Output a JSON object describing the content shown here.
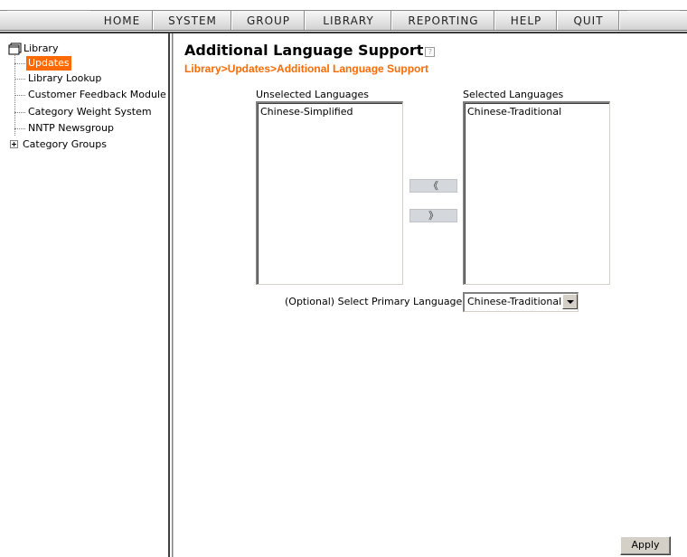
{
  "menu": {
    "items": [
      "HOME",
      "SYSTEM",
      "GROUP",
      "LIBRARY",
      "REPORTING",
      "HELP",
      "QUIT"
    ]
  },
  "sidebar": {
    "root": {
      "label": "Library",
      "icon": "folder-icon"
    },
    "items": [
      {
        "label": "Updates",
        "selected": true
      },
      {
        "label": "Library Lookup"
      },
      {
        "label": "Customer Feedback Module"
      },
      {
        "label": "Category Weight System"
      },
      {
        "label": "NNTP Newsgroup"
      },
      {
        "label": "Category Groups",
        "expandable": true
      }
    ]
  },
  "main": {
    "title": "Additional Language Support",
    "help_icon": "?",
    "breadcrumb": "Library>Updates>Additional Language Support",
    "unselected": {
      "label": "Unselected Languages",
      "options": [
        "Chinese-Simplified"
      ]
    },
    "selected": {
      "label": "Selected Languages",
      "options": [
        "Chinese-Traditional"
      ]
    },
    "move_left_label": "《",
    "move_right_label": "》",
    "primary_language": {
      "label": "(Optional) Select Primary Language:",
      "value": "Chinese-Traditional"
    },
    "apply_label": "Apply"
  },
  "colors": {
    "accent": "#ff6a00",
    "menubar": "#e0e0e0",
    "button_face": "#d4d0c8"
  }
}
